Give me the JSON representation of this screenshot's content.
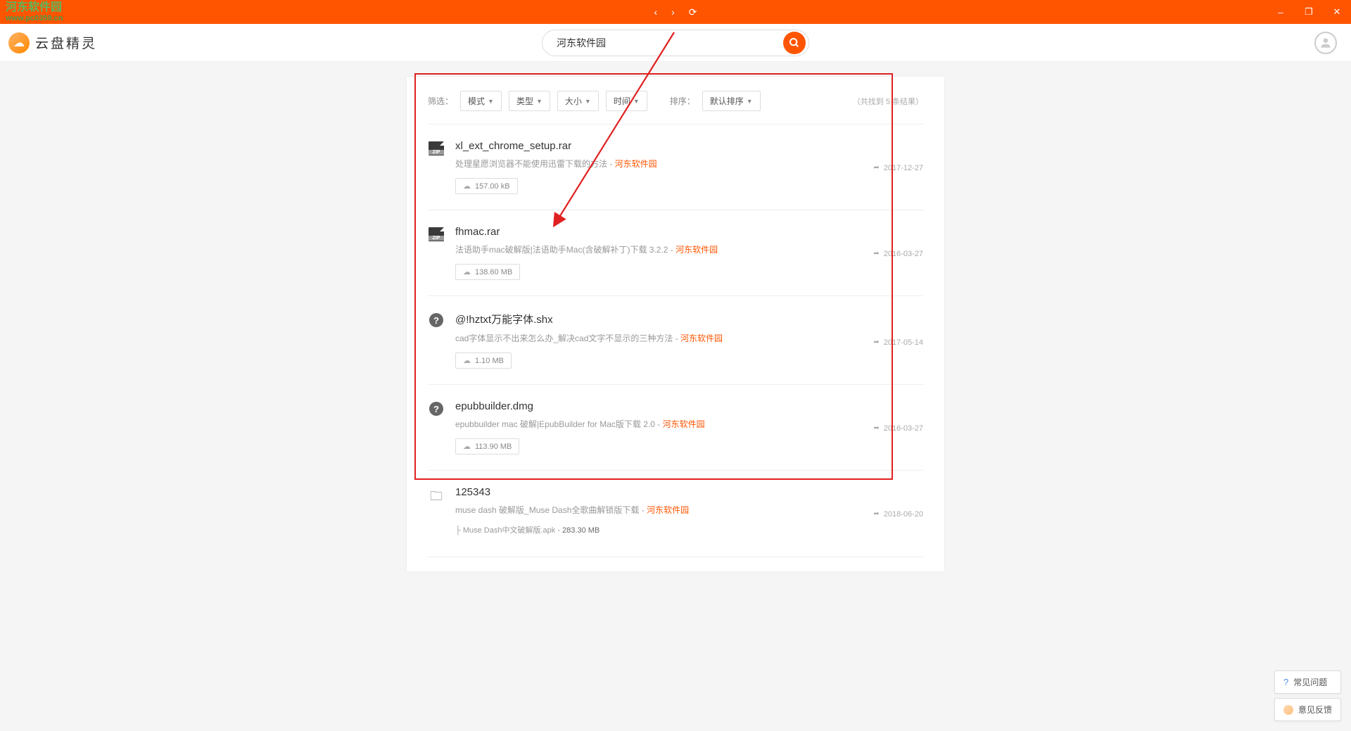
{
  "watermark": {
    "line1": "河东软件园",
    "line2": "www.pc0359.cn"
  },
  "logo": {
    "text": "云盘精灵"
  },
  "search": {
    "value": "河东软件园"
  },
  "filters": {
    "label": "筛选：",
    "mode": "模式",
    "type": "类型",
    "size": "大小",
    "time": "时间"
  },
  "sort": {
    "label": "排序：",
    "default": "默认排序"
  },
  "result_count": "（共找到 5 条结果）",
  "float": {
    "faq": "常见问题",
    "feedback": "意见反馈"
  },
  "results": [
    {
      "icon": "zip",
      "title": "xl_ext_chrome_setup.rar",
      "desc_pre": "处理星愿浏览器不能使用迅雷下载的方法 - ",
      "desc_hi": "河东软件园",
      "date": "2017-12-27",
      "size": "157.00 kB"
    },
    {
      "icon": "zip",
      "title": "fhmac.rar",
      "desc_pre": "法语助手mac破解版|法语助手Mac(含破解补丁)下载 3.2.2 - ",
      "desc_hi": "河东软件园",
      "date": "2016-03-27",
      "size": "138.60 MB"
    },
    {
      "icon": "question",
      "title": "@!hztxt万能字体.shx",
      "desc_pre": "cad字体显示不出来怎么办_解决cad文字不显示的三种方法 - ",
      "desc_hi": "河东软件园",
      "date": "2017-05-14",
      "size": "1.10 MB"
    },
    {
      "icon": "question",
      "title": "epubbuilder.dmg",
      "desc_pre": "epubbuilder mac 破解|EpubBuilder for Mac版下载 2.0 - ",
      "desc_hi": "河东软件园",
      "date": "2016-03-27",
      "size": "113.90 MB"
    },
    {
      "icon": "folder",
      "title": "125343",
      "desc_pre": "muse dash 破解版_Muse Dash全歌曲解锁版下载 - ",
      "desc_hi": "河东软件园",
      "date": "2018-06-20",
      "subfile_name": "├ Muse Dash中文破解版.apk - ",
      "subfile_size": "283.30 MB"
    }
  ]
}
